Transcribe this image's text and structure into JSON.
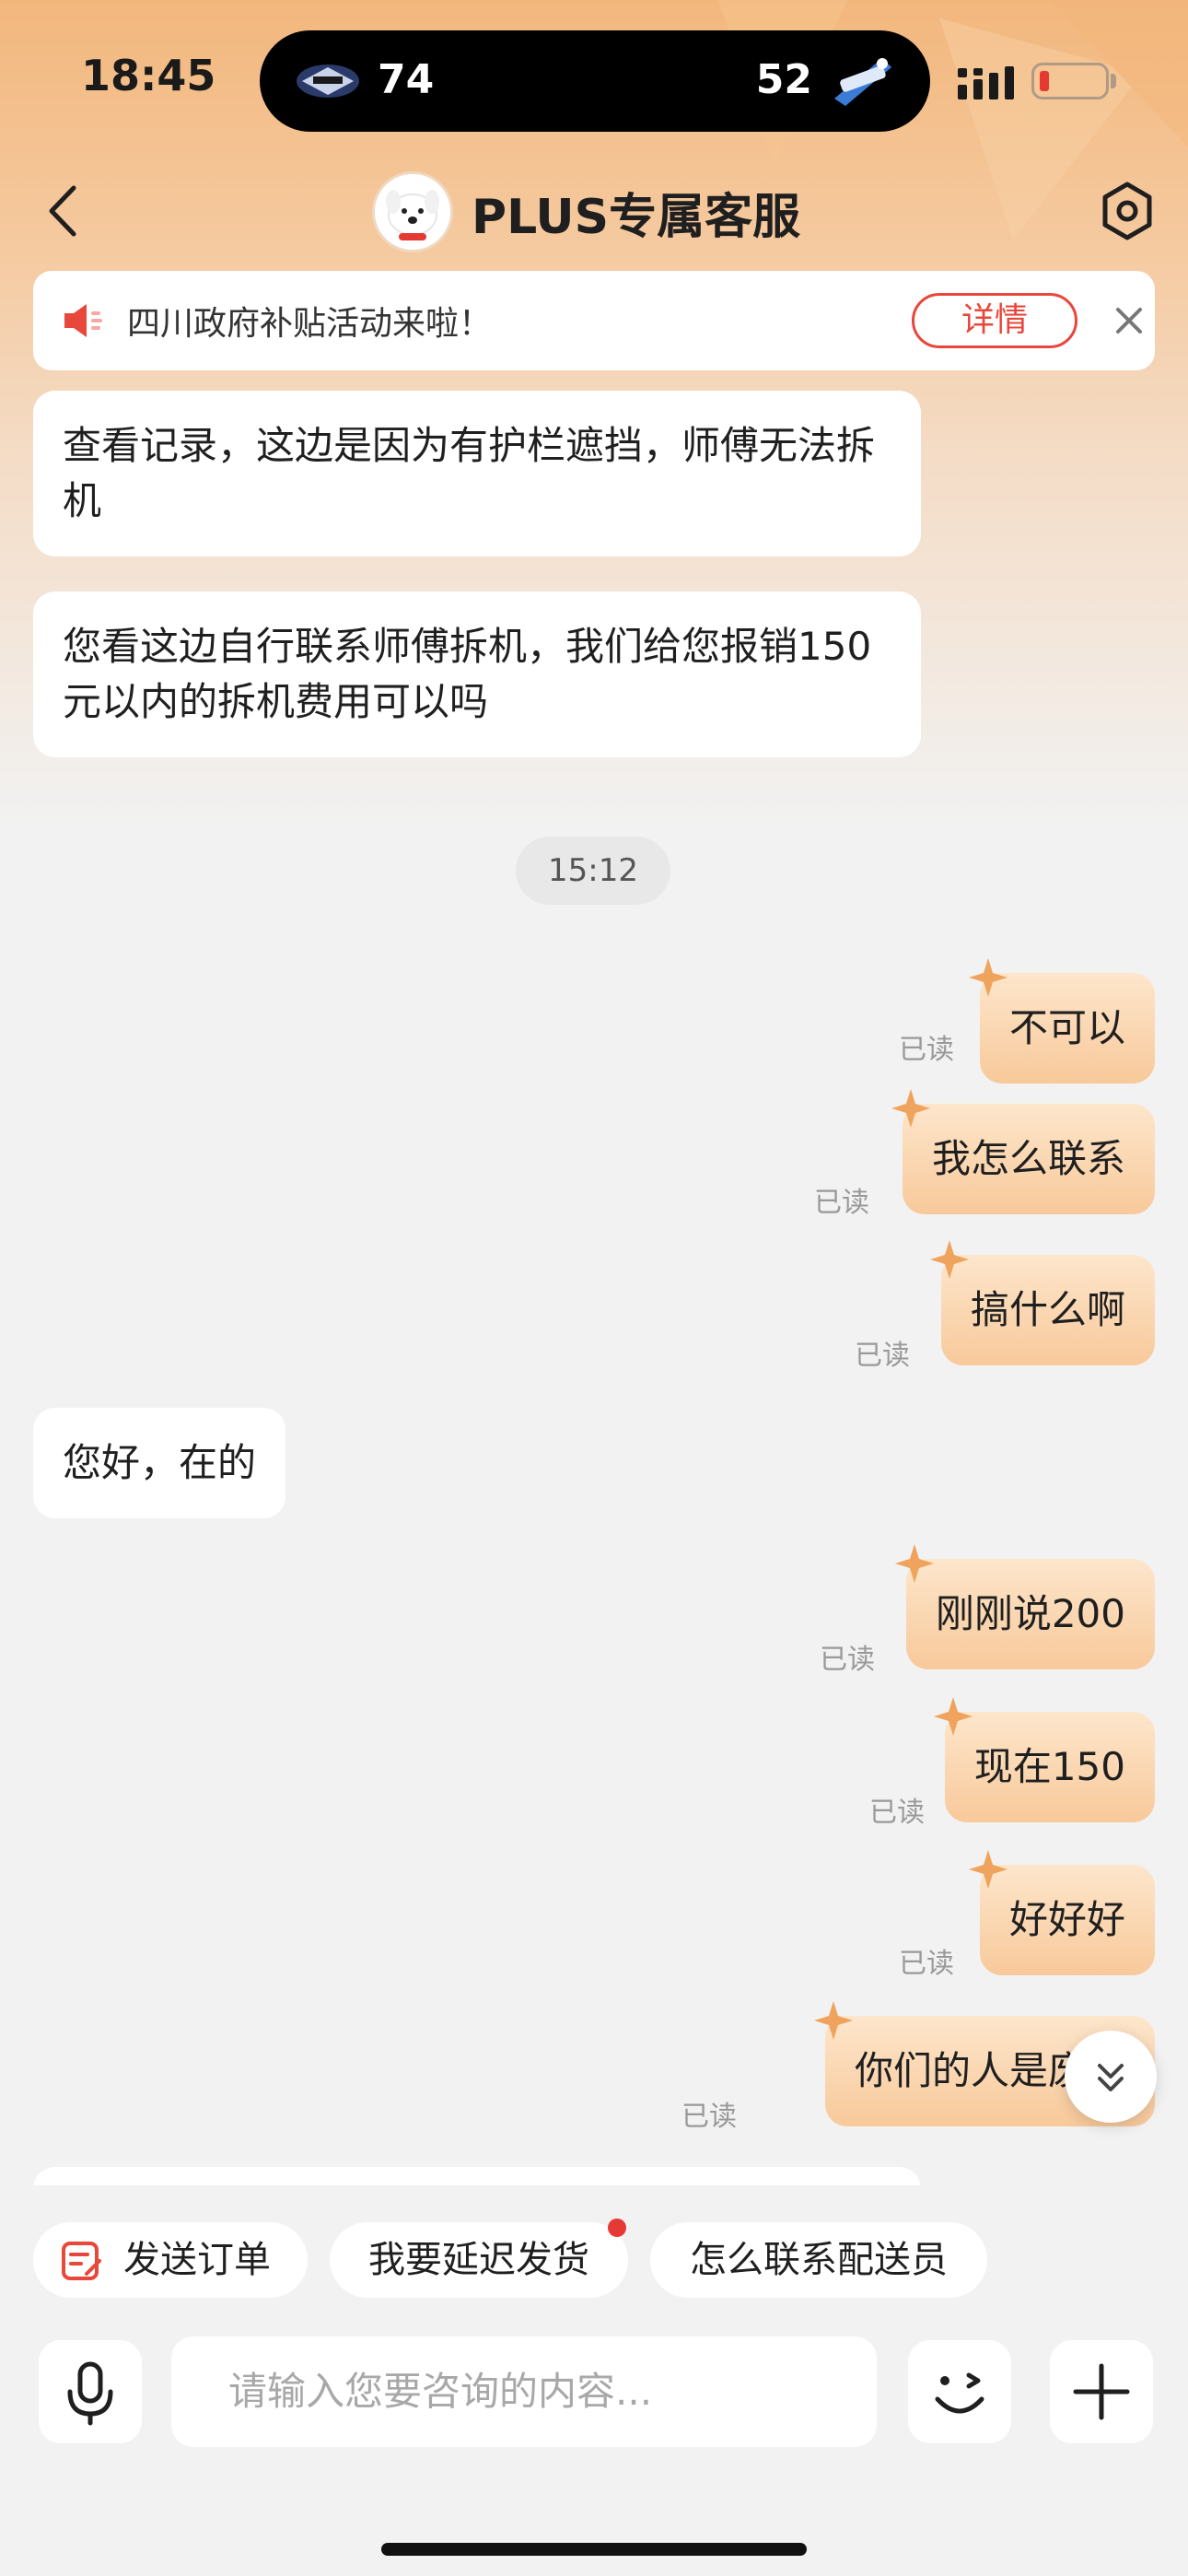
{
  "status_bar": {
    "time": "18:45",
    "score_left": "74",
    "score_right": "52",
    "team_left_icon": "team-logo-icon",
    "team_right_icon": "rockets-logo-icon"
  },
  "nav": {
    "title": "PLUS专属客服",
    "back_icon": "chevron-left-icon",
    "settings_icon": "settings-hex-icon"
  },
  "notice": {
    "text": "四川政府补贴活动来啦！",
    "detail_label": "详情",
    "icon": "speaker-icon"
  },
  "messages": [
    {
      "side": "left",
      "text": "查看记录，这边是因为有护栏遮挡，师傅无法拆机"
    },
    {
      "side": "left",
      "text": "您看这边自行联系师傅拆机，我们给您报销150元以内的拆机费用可以吗"
    },
    {
      "type": "time",
      "text": "15:12"
    },
    {
      "side": "right",
      "text": "不可以",
      "status": "已读"
    },
    {
      "side": "right",
      "text": "我怎么联系",
      "status": "已读"
    },
    {
      "side": "right",
      "text": "搞什么啊",
      "status": "已读"
    },
    {
      "side": "left",
      "text": "您好，在的"
    },
    {
      "side": "right",
      "text": "刚刚说200",
      "status": "已读"
    },
    {
      "side": "right",
      "text": "现在150",
      "status": "已读"
    },
    {
      "side": "right",
      "text": "好好好",
      "status": "已读"
    },
    {
      "side": "right",
      "text": "你们的人是废物",
      "status": "已读"
    }
  ],
  "quick_replies": [
    {
      "label": "发送订单",
      "icon": "order-icon"
    },
    {
      "label": "我要延迟发货",
      "badge": true
    },
    {
      "label": "怎么联系配送员"
    }
  ],
  "input": {
    "placeholder": "请输入您要咨询的内容...",
    "mic_icon": "microphone-icon",
    "emoji_icon": "emoji-wink-icon",
    "plus_icon": "plus-icon"
  },
  "colors": {
    "accent": "#e8473c",
    "bubble_self": "#f8c99a",
    "header_bg": "#f2b77d"
  }
}
